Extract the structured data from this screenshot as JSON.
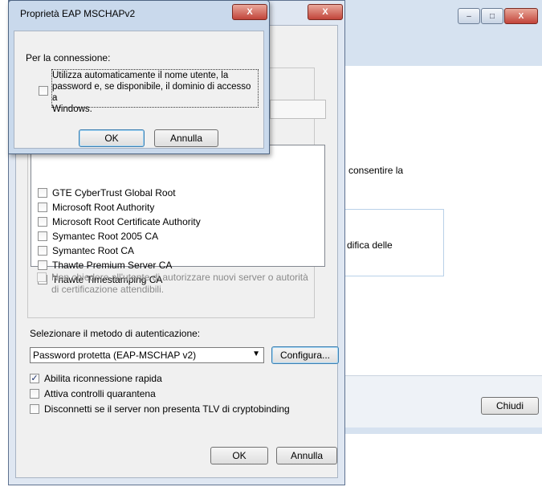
{
  "background_window": {
    "text1": "consentire la",
    "text2": "difica delle",
    "close_button": "Chiudi",
    "min_glyph": "–",
    "max_glyph": "□",
    "close_glyph": "X"
  },
  "main_dialog": {
    "close_glyph": "X",
    "certificates": [
      {
        "label": "GTE CyberTrust Global Root",
        "checked": false
      },
      {
        "label": "Microsoft Root Authority",
        "checked": false
      },
      {
        "label": "Microsoft Root Certificate Authority",
        "checked": false
      },
      {
        "label": "Symantec Root 2005 CA",
        "checked": false
      },
      {
        "label": "Symantec Root CA",
        "checked": false
      },
      {
        "label": "Thawte Premium Server CA",
        "checked": false
      },
      {
        "label": "Thawte Timestamping CA",
        "checked": false
      }
    ],
    "no_prompt_line1": "Non chiedere all'utente di autorizzare nuovi server o autorità",
    "no_prompt_line2": "di certificazione attendibili.",
    "auth_method_label": "Selezionare il metodo di autenticazione:",
    "auth_method_value": "Password protetta (EAP-MSCHAP v2)",
    "configure_button": "Configura...",
    "options": [
      {
        "label": "Abilita riconnessione rapida",
        "checked": true
      },
      {
        "label": "Attiva controlli quarantena",
        "checked": false
      },
      {
        "label": "Disconnetti se il server non presenta TLV di cryptobinding",
        "checked": false
      }
    ],
    "ok_button": "OK",
    "cancel_button": "Annulla"
  },
  "top_dialog": {
    "title": "Proprietà EAP MSCHAPv2",
    "close_glyph": "X",
    "group_label": "Per la connessione:",
    "auto_logon_line1": "Utilizza automaticamente il nome utente, la",
    "auto_logon_line2": "password e, se disponibile, il dominio di accesso a",
    "auto_logon_line3": "Windows.",
    "auto_logon_checked": false,
    "ok_button": "OK",
    "cancel_button": "Annulla"
  }
}
